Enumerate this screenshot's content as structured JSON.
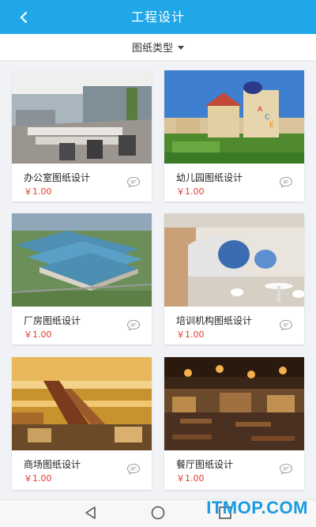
{
  "header": {
    "title": "工程设计",
    "back_icon": "chevron-left-icon"
  },
  "filter": {
    "label": "图纸类型",
    "icon": "caret-down-icon"
  },
  "cards": [
    {
      "name": "办公室图纸设计",
      "price": "￥1.00",
      "image": "office-photo"
    },
    {
      "name": "幼儿园图纸设计",
      "price": "￥1.00",
      "image": "kindergarten-photo"
    },
    {
      "name": "厂房图纸设计",
      "price": "￥1.00",
      "image": "factory-photo"
    },
    {
      "name": "培训机构图纸设计",
      "price": "￥1.00",
      "image": "training-center-photo"
    },
    {
      "name": "商场图纸设计",
      "price": "￥1.00",
      "image": "mall-photo"
    },
    {
      "name": "餐厅图纸设计",
      "price": "￥1.00",
      "image": "restaurant-photo"
    }
  ],
  "navbar": {
    "back": "triangle-back-icon",
    "home": "circle-home-icon",
    "recent": "square-recent-icon"
  },
  "watermark": "ITMOP.COM",
  "colors": {
    "header": "#1fa7e8",
    "price": "#e23b2e",
    "watermark": "#1a9be0"
  }
}
